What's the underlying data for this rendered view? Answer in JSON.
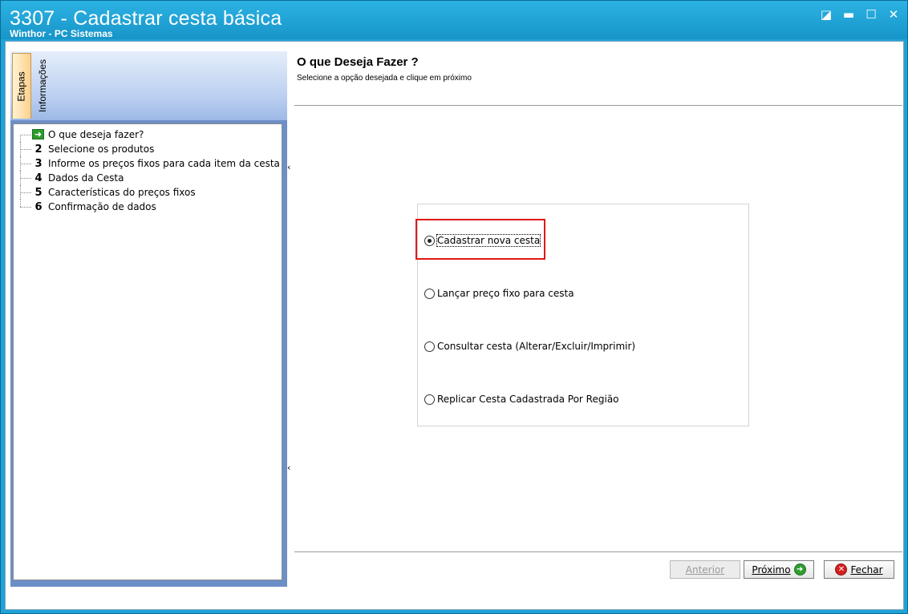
{
  "window": {
    "title": "3307 - Cadastrar cesta básica",
    "subtitle": "Winthor - PC Sistemas",
    "controls": [
      "◪",
      "▬",
      "☐",
      "✕"
    ]
  },
  "sidebar": {
    "tabs": [
      "Etapas",
      "Informações"
    ],
    "steps": [
      {
        "num": "",
        "label": "O que deseja fazer?"
      },
      {
        "num": "2",
        "label": "Selecione os produtos"
      },
      {
        "num": "3",
        "label": "Informe os preços fixos para cada item da cesta"
      },
      {
        "num": "4",
        "label": "Dados da Cesta"
      },
      {
        "num": "5",
        "label": "Características do preços fixos"
      },
      {
        "num": "6",
        "label": "Confirmação de dados"
      }
    ]
  },
  "main": {
    "title": "O que Deseja Fazer ?",
    "subtitle": "Selecione a opção desejada e clique em próximo",
    "options": [
      {
        "label": "Cadastrar nova cesta",
        "checked": true
      },
      {
        "label": "Lançar preço fixo para cesta",
        "checked": false
      },
      {
        "label": "Consultar cesta (Alterar/Excluir/Imprimir)",
        "checked": false
      },
      {
        "label": "Replicar Cesta Cadastrada Por Região",
        "checked": false
      }
    ]
  },
  "buttons": {
    "anterior": "Anterior",
    "proximo": "Próximo",
    "fechar": "Fechar"
  },
  "colors": {
    "titlebar": "#1fa3d6",
    "highlight": "#e01818"
  }
}
